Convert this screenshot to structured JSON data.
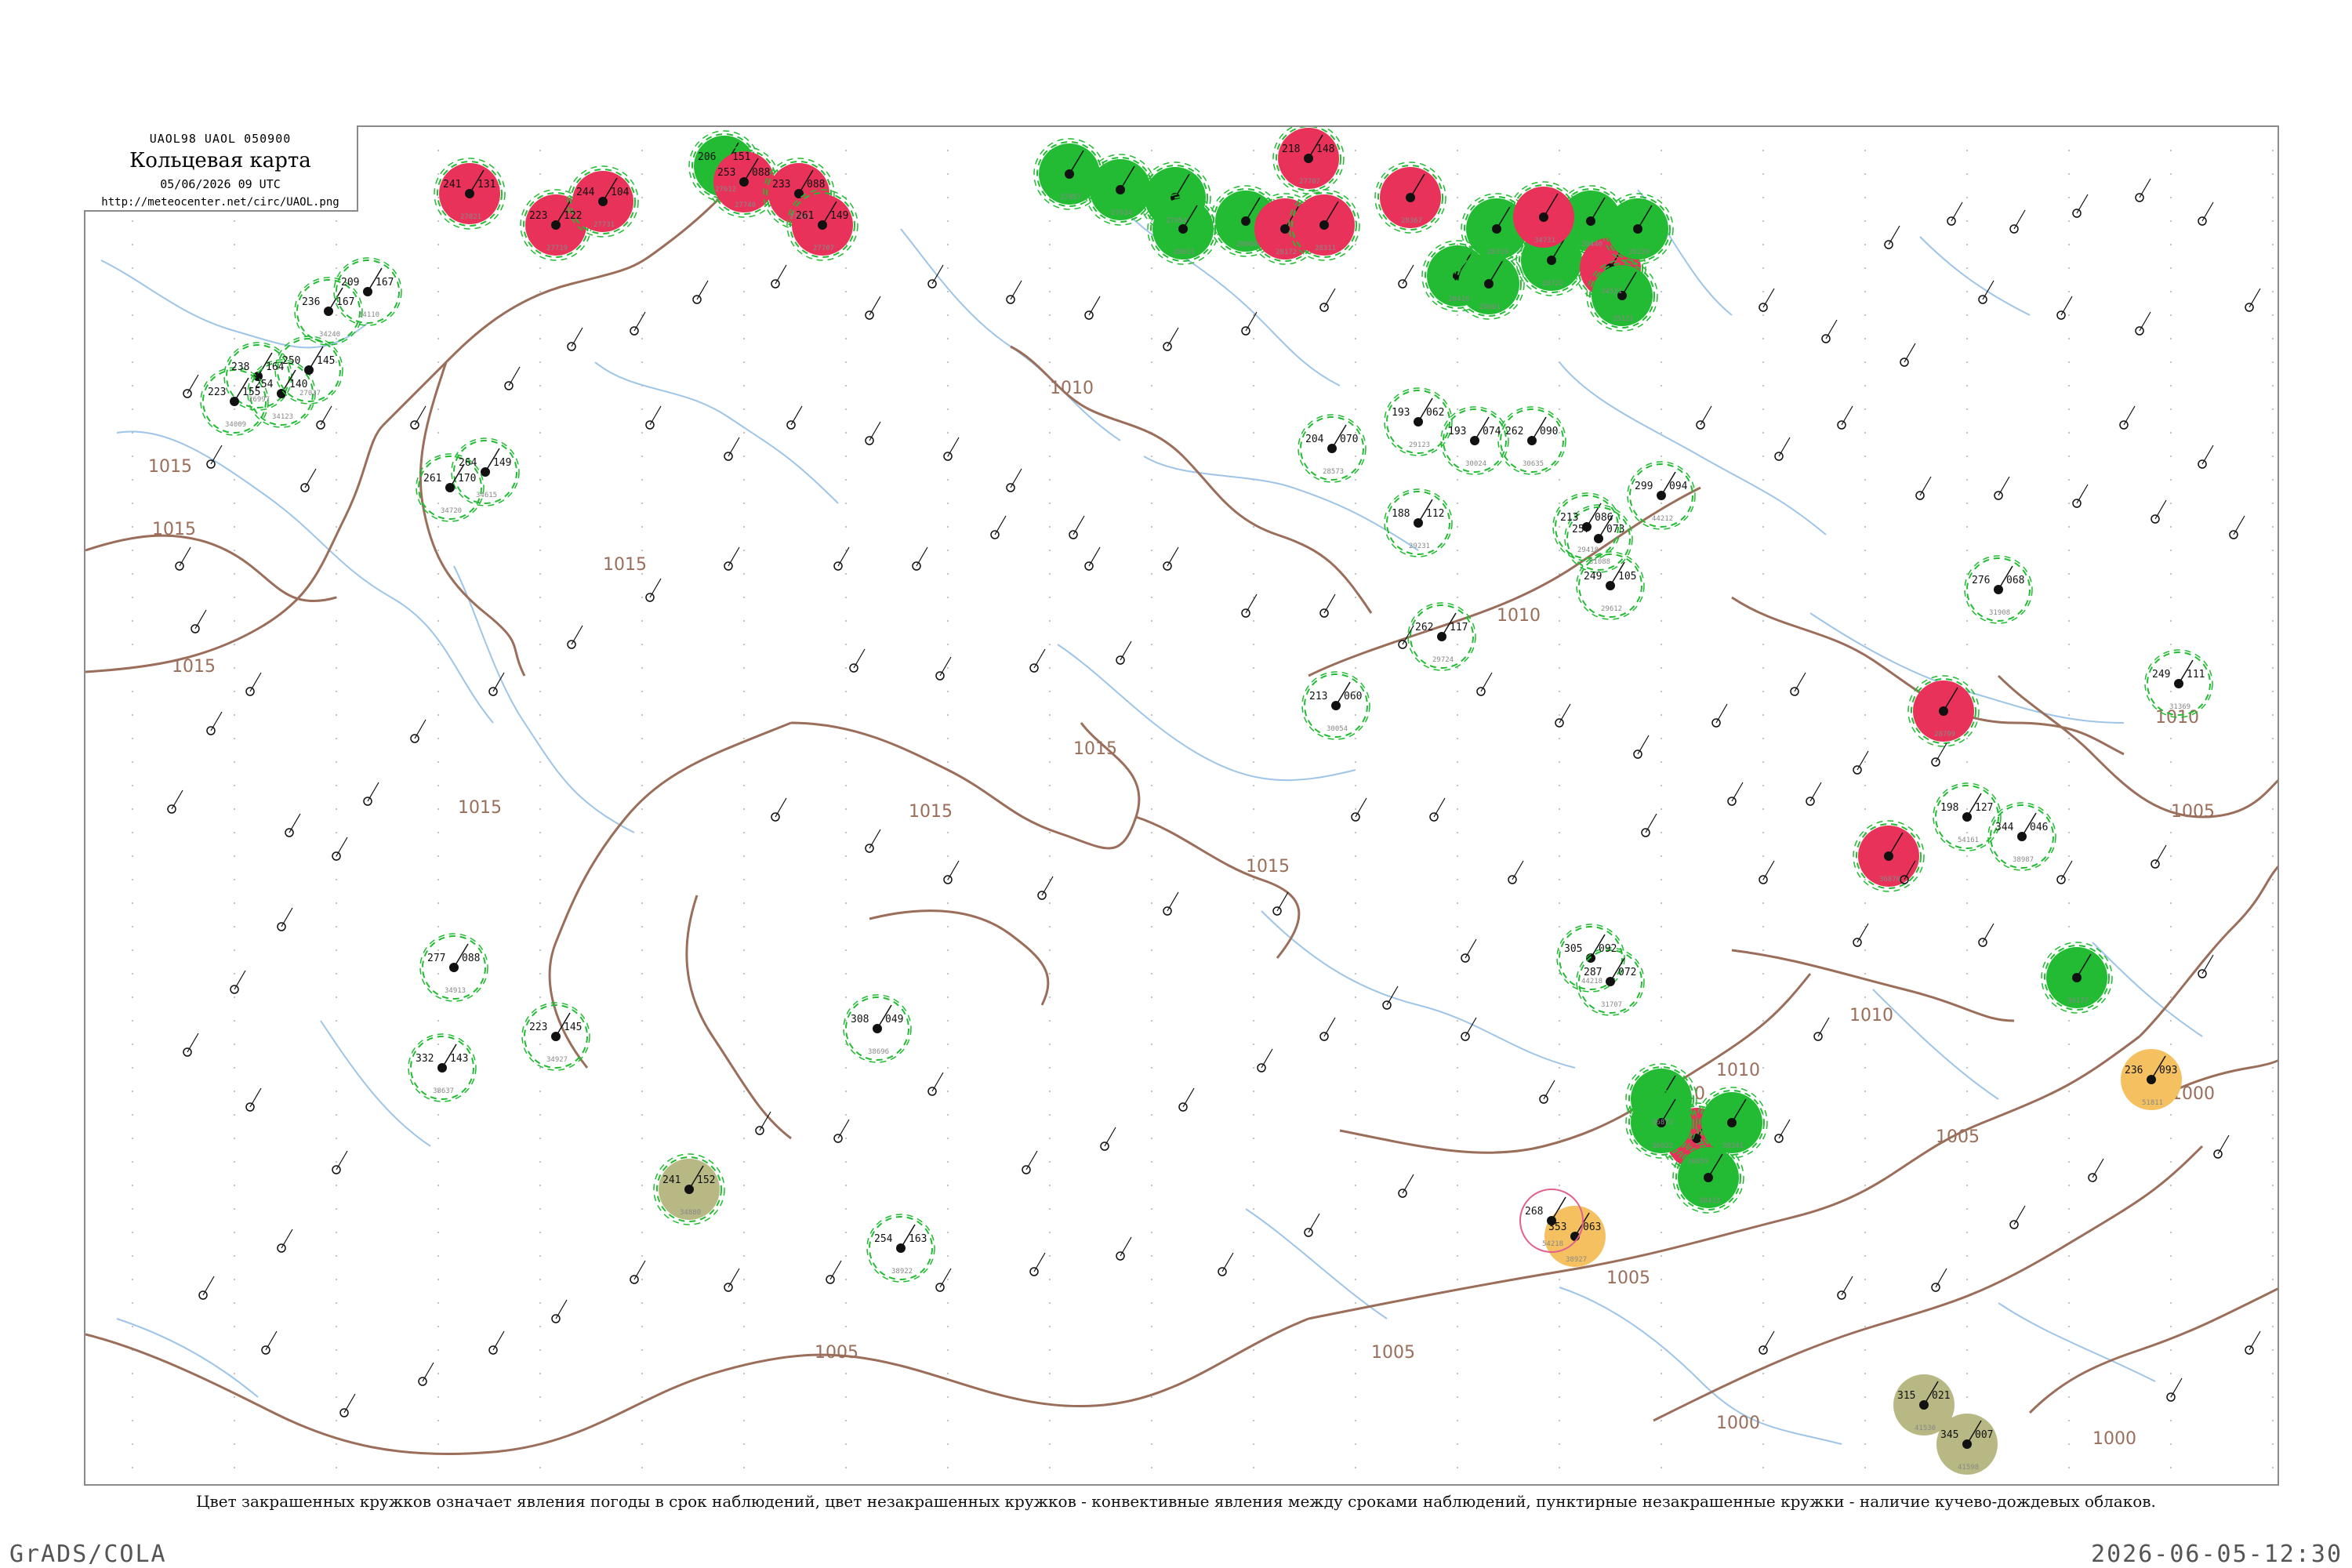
{
  "header": {
    "code": "UAOL98  UAOL  050900",
    "name": "Кольцевая карта",
    "date": "05/06/2026 09 UTC",
    "url": "http://meteocenter.net/circ/UAOL.png"
  },
  "caption": "Цвет закрашенных кружков означает явления погоды в срок наблюдений, цвет незакрашенных кружков - конвективные явления между сроками наблюдений, пунктирные незакрашенные кружки - наличие кучево-дождевых облаков.",
  "footer": {
    "left": "GrADS/COLA",
    "right": "2026-06-05-12:30"
  },
  "colors": {
    "thunderstorm": "#e8325a",
    "shower": "#22bb33",
    "dust": "#b8b884",
    "haze": "#f5c160",
    "convective_ring": "#22bb33",
    "lightning_ring": "#e06090",
    "isobar": "#9a6e5a",
    "river": "#9ec5e8"
  },
  "isobar_labels": [
    "1015",
    "1015",
    "1015",
    "1015",
    "1015",
    "1015",
    "1015",
    "1015",
    "1010",
    "1010",
    "1010",
    "1010",
    "1010",
    "1010",
    "1005",
    "1005",
    "1005",
    "1005",
    "1005",
    "1000",
    "1000",
    "1000"
  ],
  "stations": [
    {
      "kind": "shower",
      "ring": "dashed",
      "t": "206",
      "p": "151",
      "td": "",
      "id": "27612"
    },
    {
      "kind": "thunderstorm",
      "ring": "dashed",
      "t": "218",
      "p": "148",
      "td": "",
      "id": "27707"
    },
    {
      "kind": "thunderstorm",
      "ring": "dashed",
      "t": "223",
      "p": "122",
      "td": "",
      "id": "27719"
    },
    {
      "kind": "thunderstorm",
      "ring": "dashed",
      "t": "244",
      "p": "104",
      "td": "",
      "id": "27731"
    },
    {
      "kind": "thunderstorm",
      "ring": "dashed",
      "t": "253",
      "p": "088",
      "td": "",
      "id": "27740"
    },
    {
      "kind": "thunderstorm",
      "ring": "dashed",
      "t": "241",
      "p": "131",
      "td": "",
      "id": "27821"
    },
    {
      "kind": "thunderstorm",
      "ring": "dashed",
      "t": "233",
      "p": "088",
      "td": "",
      "id": "27837"
    },
    {
      "kind": "thunderstorm",
      "ring": "dashed",
      "t": "261",
      "p": "149",
      "td": "",
      "id": "27707"
    },
    {
      "kind": "shower",
      "ring": "dashed",
      "t": "",
      "p": "",
      "td": "",
      "id": "27857"
    },
    {
      "kind": "shower",
      "ring": "dashed",
      "t": "",
      "p": "",
      "td": "",
      "id": "27934"
    },
    {
      "kind": "shower",
      "ring": "dashed",
      "t": "",
      "p": "",
      "td": "",
      "id": "27954"
    },
    {
      "kind": "shower",
      "ring": "dashed",
      "t": "",
      "p": "",
      "td": "",
      "id": "28011"
    },
    {
      "kind": "shower",
      "ring": "dashed",
      "t": "",
      "p": "",
      "td": "",
      "id": "28060"
    },
    {
      "kind": "thunderstorm",
      "ring": "dashed",
      "t": "",
      "p": "",
      "td": "",
      "id": "28172"
    },
    {
      "kind": "thunderstorm",
      "ring": "dashed",
      "t": "",
      "p": "",
      "td": "",
      "id": "28311"
    },
    {
      "kind": "thunderstorm",
      "ring": "dashed",
      "t": "",
      "p": "",
      "td": "",
      "id": "28367"
    },
    {
      "kind": "shower",
      "ring": "dashed",
      "t": "",
      "p": "",
      "td": "",
      "id": "28418"
    },
    {
      "kind": "shower",
      "ring": "dashed",
      "t": "",
      "p": "",
      "td": "",
      "id": "28440"
    },
    {
      "kind": "shower",
      "ring": "dashed",
      "t": "",
      "p": "",
      "td": "",
      "id": "28661"
    },
    {
      "kind": "shower",
      "ring": "dashed",
      "t": "",
      "p": "",
      "td": "",
      "id": "28719"
    },
    {
      "kind": "shower",
      "ring": "dashed",
      "t": "",
      "p": "",
      "td": "",
      "id": "28722"
    },
    {
      "kind": "thunderstorm",
      "ring": "dashed",
      "t": "",
      "p": "",
      "td": "",
      "id": "34521"
    },
    {
      "kind": "thunderstorm",
      "ring": "dashed",
      "t": "",
      "p": "",
      "td": "",
      "id": "34731"
    },
    {
      "kind": "shower",
      "ring": "dashed",
      "t": "",
      "p": "",
      "td": "",
      "id": "35121"
    },
    {
      "kind": "shower",
      "ring": "dashed",
      "t": "",
      "p": "",
      "td": "",
      "id": "35229"
    },
    {
      "kind": "thunderstorm",
      "ring": "dashed",
      "t": "",
      "p": "",
      "td": "",
      "id": "28799"
    },
    {
      "kind": "shower",
      "ring": "dashed",
      "t": "",
      "p": "",
      "td": "",
      "id": "36177"
    },
    {
      "kind": "thunderstorm",
      "ring": "dashed",
      "t": "",
      "p": "",
      "td": "",
      "id": "36870"
    },
    {
      "kind": "thunderstorm",
      "ring": "dashed",
      "t": "",
      "p": "",
      "td": "",
      "id": "36859"
    },
    {
      "kind": "shower",
      "ring": "dashed",
      "t": "",
      "p": "",
      "td": "",
      "id": "36872"
    },
    {
      "kind": "shower",
      "ring": "dashed",
      "t": "",
      "p": "",
      "td": "",
      "id": "38341"
    },
    {
      "kind": "shower",
      "ring": "dashed",
      "t": "",
      "p": "",
      "td": "",
      "id": "36022"
    },
    {
      "kind": "shower",
      "ring": "dashed",
      "t": "",
      "p": "",
      "td": "",
      "id": "38413"
    },
    {
      "kind": "dust",
      "ring": "dashed",
      "t": "241",
      "p": "152",
      "td": "",
      "id": "34880"
    },
    {
      "kind": "haze",
      "ring": "none",
      "t": "353",
      "p": "063",
      "td": "",
      "id": "38927"
    },
    {
      "kind": "haze",
      "ring": "none",
      "t": "236",
      "p": "093",
      "td": "",
      "id": "51811"
    },
    {
      "kind": "dust",
      "ring": "none",
      "t": "315",
      "p": "021",
      "td": "",
      "id": "41530"
    },
    {
      "kind": "dust",
      "ring": "none",
      "t": "345",
      "p": "007",
      "td": "",
      "id": "41598"
    },
    {
      "kind": "none",
      "ring": "dashed",
      "t": "238",
      "p": "164",
      "td": "",
      "id": "26997"
    },
    {
      "kind": "none",
      "ring": "dashed",
      "t": "223",
      "p": "155",
      "td": "",
      "id": "34009"
    },
    {
      "kind": "none",
      "ring": "dashed",
      "t": "254",
      "p": "140",
      "td": "",
      "id": "34123"
    },
    {
      "kind": "none",
      "ring": "dashed",
      "t": "250",
      "p": "145",
      "td": "",
      "id": "27037"
    },
    {
      "kind": "none",
      "ring": "dashed",
      "t": "236",
      "p": "167",
      "td": "",
      "id": "34240"
    },
    {
      "kind": "none",
      "ring": "dashed",
      "t": "209",
      "p": "167",
      "td": "",
      "id": "34110"
    },
    {
      "kind": "none",
      "ring": "dashed",
      "t": "264",
      "p": "149",
      "td": "",
      "id": "34615"
    },
    {
      "kind": "none",
      "ring": "dashed",
      "t": "261",
      "p": "170",
      "td": "",
      "id": "34720"
    },
    {
      "kind": "none",
      "ring": "dashed",
      "t": "277",
      "p": "088",
      "td": "",
      "id": "34913"
    },
    {
      "kind": "none",
      "ring": "dashed",
      "t": "223",
      "p": "145",
      "td": "",
      "id": "34927"
    },
    {
      "kind": "none",
      "ring": "dashed",
      "t": "332",
      "p": "143",
      "td": "",
      "id": "38637"
    },
    {
      "kind": "none",
      "ring": "dashed",
      "t": "308",
      "p": "049",
      "td": "",
      "id": "38696"
    },
    {
      "kind": "none",
      "ring": "dashed",
      "t": "254",
      "p": "163",
      "td": "",
      "id": "38922"
    },
    {
      "kind": "none",
      "ring": "dashed",
      "t": "204",
      "p": "070",
      "td": "",
      "id": "28573"
    },
    {
      "kind": "none",
      "ring": "dashed",
      "t": "193",
      "p": "062",
      "td": "",
      "id": "29123"
    },
    {
      "kind": "none",
      "ring": "dashed",
      "t": "188",
      "p": "112",
      "td": "",
      "id": "29231"
    },
    {
      "kind": "none",
      "ring": "dashed",
      "t": "213",
      "p": "086",
      "td": "",
      "id": "29418"
    },
    {
      "kind": "none",
      "ring": "dashed",
      "t": "249",
      "p": "105",
      "td": "",
      "id": "29612"
    },
    {
      "kind": "none",
      "ring": "dashed",
      "t": "262",
      "p": "117",
      "td": "",
      "id": "29724"
    },
    {
      "kind": "none",
      "ring": "dashed",
      "t": "213",
      "p": "060",
      "td": "",
      "id": "30054"
    },
    {
      "kind": "none",
      "ring": "dashed",
      "t": "193",
      "p": "074",
      "td": "",
      "id": "30024"
    },
    {
      "kind": "none",
      "ring": "dashed",
      "t": "262",
      "p": "090",
      "td": "",
      "id": "30635"
    },
    {
      "kind": "none",
      "ring": "dashed",
      "t": "257",
      "p": "073",
      "td": "",
      "id": "31088"
    },
    {
      "kind": "none",
      "ring": "dashed",
      "t": "299",
      "p": "094",
      "td": "",
      "id": "44212"
    },
    {
      "kind": "none",
      "ring": "dashed",
      "t": "305",
      "p": "092",
      "td": "",
      "id": "44218"
    },
    {
      "kind": "none",
      "ring": "dashed",
      "t": "287",
      "p": "072",
      "td": "",
      "id": "31707"
    },
    {
      "kind": "none",
      "ring": "dashed",
      "t": "276",
      "p": "068",
      "td": "",
      "id": "31908"
    },
    {
      "kind": "none",
      "ring": "dashed",
      "t": "249",
      "p": "111",
      "td": "",
      "id": "31369"
    },
    {
      "kind": "none",
      "ring": "dashed",
      "t": "198",
      "p": "127",
      "td": "",
      "id": "54161"
    },
    {
      "kind": "none",
      "ring": "dashed",
      "t": "344",
      "p": "046",
      "td": "",
      "id": "38987"
    },
    {
      "kind": "none",
      "ring": "solid",
      "t": "268",
      "p": "",
      "td": "",
      "id": "54218"
    }
  ]
}
